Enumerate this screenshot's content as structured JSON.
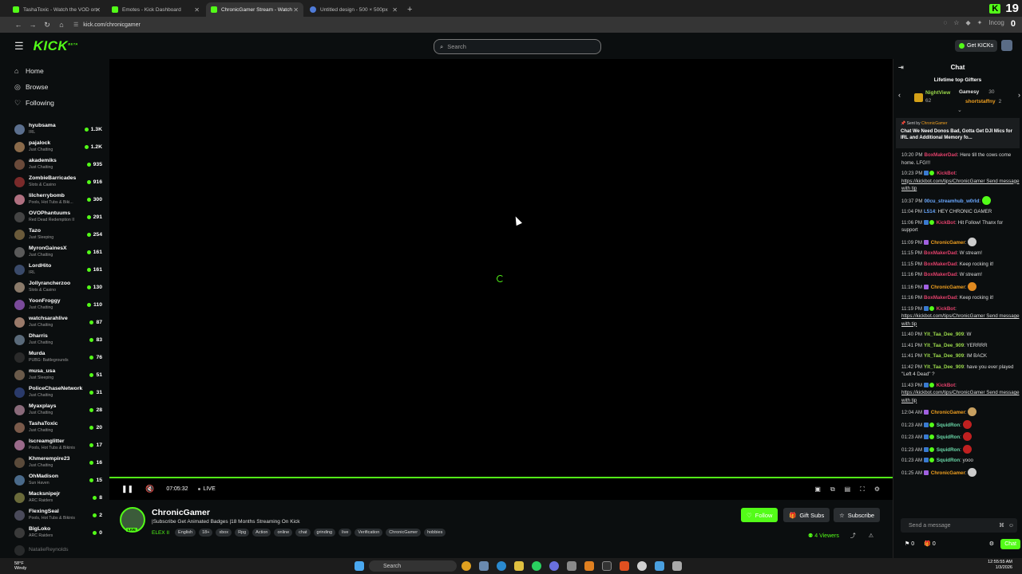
{
  "browser": {
    "tabs": [
      {
        "title": "TashaToxic - Watch the VOD on",
        "active": false
      },
      {
        "title": "Emotes - Kick Dashboard",
        "active": false
      },
      {
        "title": "ChronicGamer Stream - Watch",
        "active": true
      },
      {
        "title": "Untitled design - 500 × 500px",
        "active": false
      }
    ],
    "new_tab": "+",
    "url": "kick.com/chronicgamer",
    "kick_badge": "K",
    "kick_count": "19",
    "ext_count": "0",
    "incognito": "Incog"
  },
  "header": {
    "logo": "KICK",
    "logo_beta": "BETA",
    "search_placeholder": "Search",
    "get_kicks": "Get KICKs"
  },
  "sidebar": {
    "nav": [
      {
        "label": "Home",
        "icon": "home-icon"
      },
      {
        "label": "Browse",
        "icon": "compass-icon"
      },
      {
        "label": "Following",
        "icon": "heart-icon"
      }
    ],
    "channels": [
      {
        "name": "hyubsama",
        "category": "IRL",
        "viewers": "1.3K",
        "color": "#5b6f8e"
      },
      {
        "name": "pajalock",
        "category": "Just Chatting",
        "viewers": "1.2K",
        "color": "#8a6a4a"
      },
      {
        "name": "akademiks",
        "category": "Just Chatting",
        "viewers": "935",
        "color": "#6a4a3a"
      },
      {
        "name": "ZombieBarricades",
        "category": "Slots & Casino",
        "viewers": "916",
        "color": "#7a2a2a"
      },
      {
        "name": "lilcherrybomb",
        "category": "Pools, Hot Tubs & Biki...",
        "viewers": "300",
        "color": "#b07080"
      },
      {
        "name": "OVOPhantuums",
        "category": "Red Dead Redemption II",
        "viewers": "291",
        "color": "#444"
      },
      {
        "name": "Tazo",
        "category": "Just Sleeping",
        "viewers": "254",
        "color": "#6a5a3a"
      },
      {
        "name": "MyronGainesX",
        "category": "Just Chatting",
        "viewers": "161",
        "color": "#5a5a5a"
      },
      {
        "name": "LordHito",
        "category": "IRL",
        "viewers": "161",
        "color": "#3a4a6a"
      },
      {
        "name": "Jollyrancherzoo",
        "category": "Slots & Casino",
        "viewers": "130",
        "color": "#8a7a6a"
      },
      {
        "name": "YoonFroggy",
        "category": "Just Chatting",
        "viewers": "110",
        "color": "#7a4a9a"
      },
      {
        "name": "watchsarahlive",
        "category": "Just Chatting",
        "viewers": "87",
        "color": "#9a7a6a"
      },
      {
        "name": "Dharris",
        "category": "Just Chatting",
        "viewers": "83",
        "color": "#5a6a7a"
      },
      {
        "name": "Murda",
        "category": "PUBG: Battlegrounds",
        "viewers": "76",
        "color": "#2a2a2a"
      },
      {
        "name": "musa_usa",
        "category": "Just Sleeping",
        "viewers": "51",
        "color": "#6a5a4a"
      },
      {
        "name": "PoliceChaseNetwork",
        "category": "Just Chatting",
        "viewers": "31",
        "color": "#2a3a6a"
      },
      {
        "name": "Myaxplays",
        "category": "Just Chatting",
        "viewers": "28",
        "color": "#8a6a7a"
      },
      {
        "name": "TashaToxic",
        "category": "Just Chatting",
        "viewers": "20",
        "color": "#7a5a4a"
      },
      {
        "name": "Iscreamglitter",
        "category": "Pools, Hot Tubs & Bikinis",
        "viewers": "17",
        "color": "#9a6a8a"
      },
      {
        "name": "Khmerempire23",
        "category": "Just Chatting",
        "viewers": "16",
        "color": "#5a4a3a"
      },
      {
        "name": "OhMadison",
        "category": "Sun Haven",
        "viewers": "15",
        "color": "#4a6a8a"
      },
      {
        "name": "Macksnipejr",
        "category": "ARC Raiders",
        "viewers": "8",
        "color": "#6a6a3a"
      },
      {
        "name": "FlexingSeal",
        "category": "Pools, Hot Tubs & Bikinis",
        "viewers": "2",
        "color": "#4a4a5a"
      },
      {
        "name": "BigLoko",
        "category": "ARC Raiders",
        "viewers": "0",
        "color": "#3a3a3a"
      }
    ],
    "offline": "NatalieReynolds"
  },
  "player": {
    "elapsed": "07:05:32",
    "live": "LIVE",
    "progress": 1.0
  },
  "stream": {
    "streamer": "ChronicGamer",
    "live_badge": "LIVE",
    "title": "|Subscribe Get Animated Badges |18 Months Streaming On Kick",
    "category": "ELEX II",
    "tags": [
      "English",
      "18+",
      "xbox",
      "Rpg",
      "Action",
      "online",
      "chat",
      "grinding",
      "live",
      "Verification",
      "ChronicGamer",
      "hobbies"
    ],
    "follow": "Follow",
    "gift_subs": "Gift Subs",
    "subscribe": "Subscribe",
    "viewers": "4 Viewers"
  },
  "chat": {
    "title": "Chat",
    "lifetime_title": "Lifetime top Gifters",
    "gifters": [
      {
        "name": "NightView",
        "count": "62"
      },
      {
        "name": "Gamesy",
        "count": "30"
      },
      {
        "name": "shortstaffny",
        "count": "2"
      }
    ],
    "pinned": {
      "sent_by_label": "Sent by",
      "sender": "ChronicGamer",
      "message": "Chat We Need Donos Bad, Gotta Get DJI Mics for IRL and Additional Memory fo..."
    },
    "messages": [
      {
        "time": "10:20 PM",
        "user": "BoxMakerDad",
        "color": "#e0406a",
        "text": "Here till the cows come home. LFG!!!"
      },
      {
        "time": "10:23 PM",
        "user": "KickBot",
        "color": "#e0406a",
        "text": "https://kickbot.com/tips/ChronicGamer Send message with tip",
        "badges": true
      },
      {
        "time": "10:37 PM",
        "user": "00cu_streamhub_w0rld",
        "color": "#6aa8ff",
        "text": "",
        "emote": "#53fc18"
      },
      {
        "time": "11:04 PM",
        "user": "L514",
        "color": "#6aa8ff",
        "text": "HEY CHRONIC GAMER"
      },
      {
        "time": "11:06 PM",
        "user": "KickBot",
        "color": "#e0406a",
        "text": "Hit Follow! Thanx for support",
        "badges": true
      },
      {
        "time": "11:09 PM",
        "user": "ChronicGamer",
        "color": "#f0a020",
        "text": "",
        "emote": "#ccc"
      },
      {
        "time": "11:15 PM",
        "user": "BoxMakerDad",
        "color": "#e0406a",
        "text": "W stream!"
      },
      {
        "time": "11:15 PM",
        "user": "BoxMakerDad",
        "color": "#e0406a",
        "text": "Keep rocking it!"
      },
      {
        "time": "11:16 PM",
        "user": "BoxMakerDad",
        "color": "#e0406a",
        "text": "W stream!"
      },
      {
        "time": "11:16 PM",
        "user": "ChronicGamer",
        "color": "#f0a020",
        "text": "",
        "emote": "#e08a20"
      },
      {
        "time": "11:16 PM",
        "user": "BoxMakerDad",
        "color": "#e0406a",
        "text": "Keep rocking it!"
      },
      {
        "time": "11:19 PM",
        "user": "KickBot",
        "color": "#e0406a",
        "text": "https://kickbot.com/tips/ChronicGamer Send message with tip",
        "badges": true
      },
      {
        "time": "11:40 PM",
        "user": "Ylt_Taa_Dee_909",
        "color": "#9ad84a",
        "text": "W"
      },
      {
        "time": "11:41 PM",
        "user": "Ylt_Taa_Dee_909",
        "color": "#9ad84a",
        "text": "YERRRR"
      },
      {
        "time": "11:41 PM",
        "user": "Ylt_Taa_Dee_909",
        "color": "#9ad84a",
        "text": "IM BACK"
      },
      {
        "time": "11:42 PM",
        "user": "Ylt_Taa_Dee_909",
        "color": "#9ad84a",
        "text": "have you ever played \"Left 4 Dead\" ?"
      },
      {
        "time": "11:43 PM",
        "user": "KickBot",
        "color": "#e0406a",
        "text": "https://kickbot.com/tips/ChronicGamer Send message with tip",
        "badges": true
      },
      {
        "time": "12:04 AM",
        "user": "ChronicGamer",
        "color": "#f0a020",
        "text": "",
        "emote": "#c8a060"
      },
      {
        "time": "01:23 AM",
        "user": "SquidRon",
        "color": "#6ad8a8",
        "text": "",
        "emote": "#c02020",
        "badges": true
      },
      {
        "time": "01:23 AM",
        "user": "SquidRon",
        "color": "#6ad8a8",
        "text": "",
        "emote": "#c02020",
        "badges": true
      },
      {
        "time": "01:23 AM",
        "user": "SquidRon",
        "color": "#6ad8a8",
        "text": "",
        "emote": "#c02020",
        "badges": true
      },
      {
        "time": "01:23 AM",
        "user": "SquidRon",
        "color": "#6ad8a8",
        "text": "yooo",
        "badges": true
      },
      {
        "time": "01:25 AM",
        "user": "ChronicGamer",
        "color": "#f0a020",
        "text": "",
        "emote": "#ccc"
      }
    ],
    "input_placeholder": "Send a message",
    "footer_count_a": "0",
    "footer_count_b": "0",
    "chat_button": "Chat"
  },
  "taskbar": {
    "temp": "58°F",
    "weather": "Windy",
    "search": "Search",
    "time": "12:55:55 AM",
    "date": "1/3/2026"
  }
}
